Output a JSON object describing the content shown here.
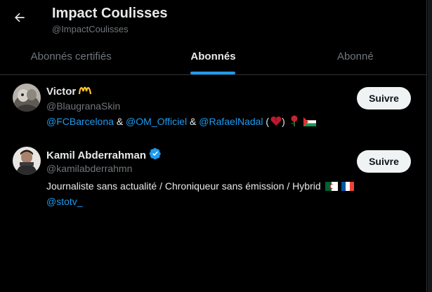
{
  "header": {
    "title": "Impact Coulisses",
    "handle": "@ImpactCoulisses"
  },
  "tabs": [
    {
      "label": "Abonnés certifiés",
      "active": false
    },
    {
      "label": "Abonnés",
      "active": true
    },
    {
      "label": "Abonné",
      "active": false
    }
  ],
  "users": [
    {
      "name": "Victor",
      "handle": "@BlaugranaSkin",
      "follow_label": "Suivre",
      "bio": {
        "mention1": "@FCBarcelona",
        "sep1": "&",
        "mention2": "@OM_Officiel",
        "sep2": "&",
        "mention3": "@RafaelNadal",
        "paren_open": "(",
        "paren_close": ")"
      }
    },
    {
      "name": "Kamil Abderrahman",
      "handle": "@kamilabderrahmn",
      "follow_label": "Suivre",
      "verified": true,
      "bio": {
        "text": "Journaliste sans actualité / Chroniqueur sans émission / Hybrid",
        "mention": "@stotv_"
      }
    }
  ],
  "colors": {
    "background": "#000000",
    "accent": "#1d9bf0",
    "muted": "#71767b",
    "text": "#e7e9ea",
    "button_bg": "#eff3f4"
  }
}
